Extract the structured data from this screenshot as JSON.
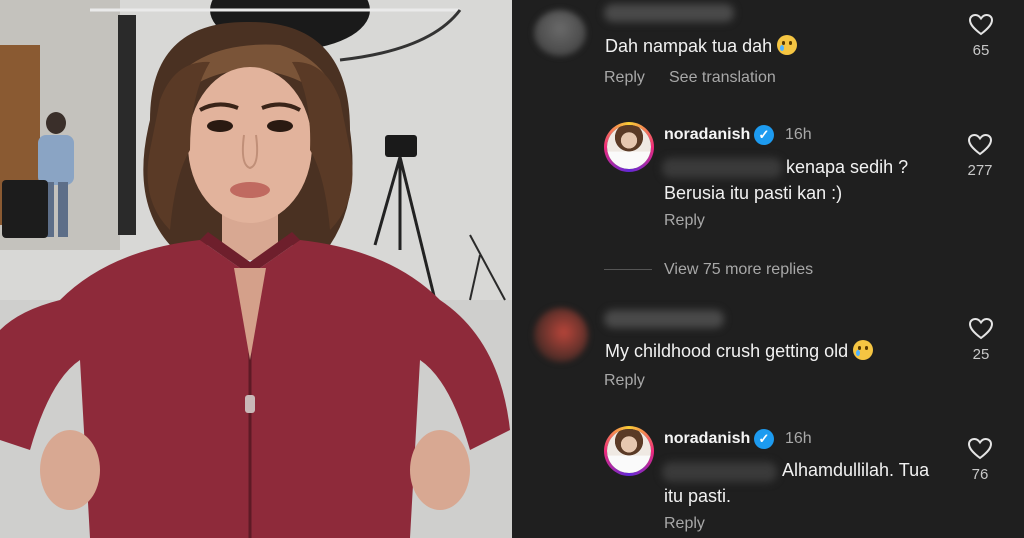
{
  "comments": [
    {
      "text": "Dah nampak tua dah",
      "emoji": "crying-face",
      "reply_label": "Reply",
      "translation_label": "See translation",
      "likes": "65",
      "replies": [
        {
          "username": "noradanish",
          "time": "16h",
          "text_line1": "kenapa sedih ?",
          "text_line2": "Berusia itu pasti kan :)",
          "reply_label": "Reply",
          "likes": "277"
        }
      ],
      "view_more_label": "View 75 more replies"
    },
    {
      "text": "My childhood crush getting old",
      "emoji": "smiling-face-with-tear",
      "reply_label": "Reply",
      "likes": "25",
      "replies": [
        {
          "username": "noradanish",
          "time": "16h",
          "text_line1": "Alhamdullilah. Tua",
          "text_line2": "itu pasti.",
          "reply_label": "Reply",
          "likes": "76"
        }
      ]
    }
  ],
  "colors": {
    "panel_bg": "#1f1f1f",
    "text": "#f1f1f1",
    "muted": "#a8a8a8",
    "verified": "#1d9bf0",
    "jacket": "#8e2a3a"
  }
}
